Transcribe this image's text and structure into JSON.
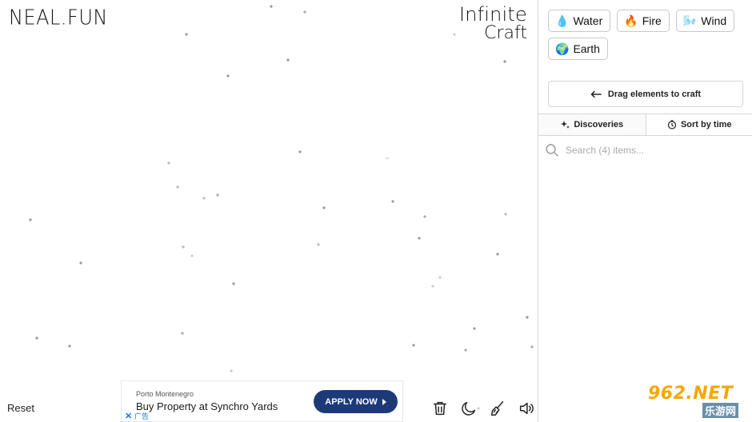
{
  "brand": "NEAL.FUN",
  "logo": {
    "line1": "Infinite",
    "line2": "Craft"
  },
  "reset_label": "Reset",
  "ad": {
    "advertiser": "Porto Montenegro",
    "headline": "Buy Property at Synchro Yards",
    "cta": "APPLY NOW",
    "close": "✕",
    "tag": "广告"
  },
  "sidebar": {
    "items": [
      {
        "emoji": "💧",
        "label": "Water"
      },
      {
        "emoji": "🔥",
        "label": "Fire"
      },
      {
        "emoji": "🌬️",
        "label": "Wind"
      },
      {
        "emoji": "🌍",
        "label": "Earth"
      }
    ],
    "drag_hint": "Drag elements to craft",
    "tabs": {
      "discoveries": "Discoveries",
      "sort": "Sort by time"
    },
    "search_placeholder": "Search (4) items..."
  },
  "watermark": {
    "text": "962.NET",
    "sub": "乐游网"
  },
  "icons": {
    "tools": [
      "trash-icon",
      "moon-icon",
      "broom-icon",
      "speaker-icon"
    ],
    "arrow": "arrow-left-icon",
    "sparkle": "sparkle-icon",
    "clock": "clock-icon",
    "search": "search-icon"
  }
}
